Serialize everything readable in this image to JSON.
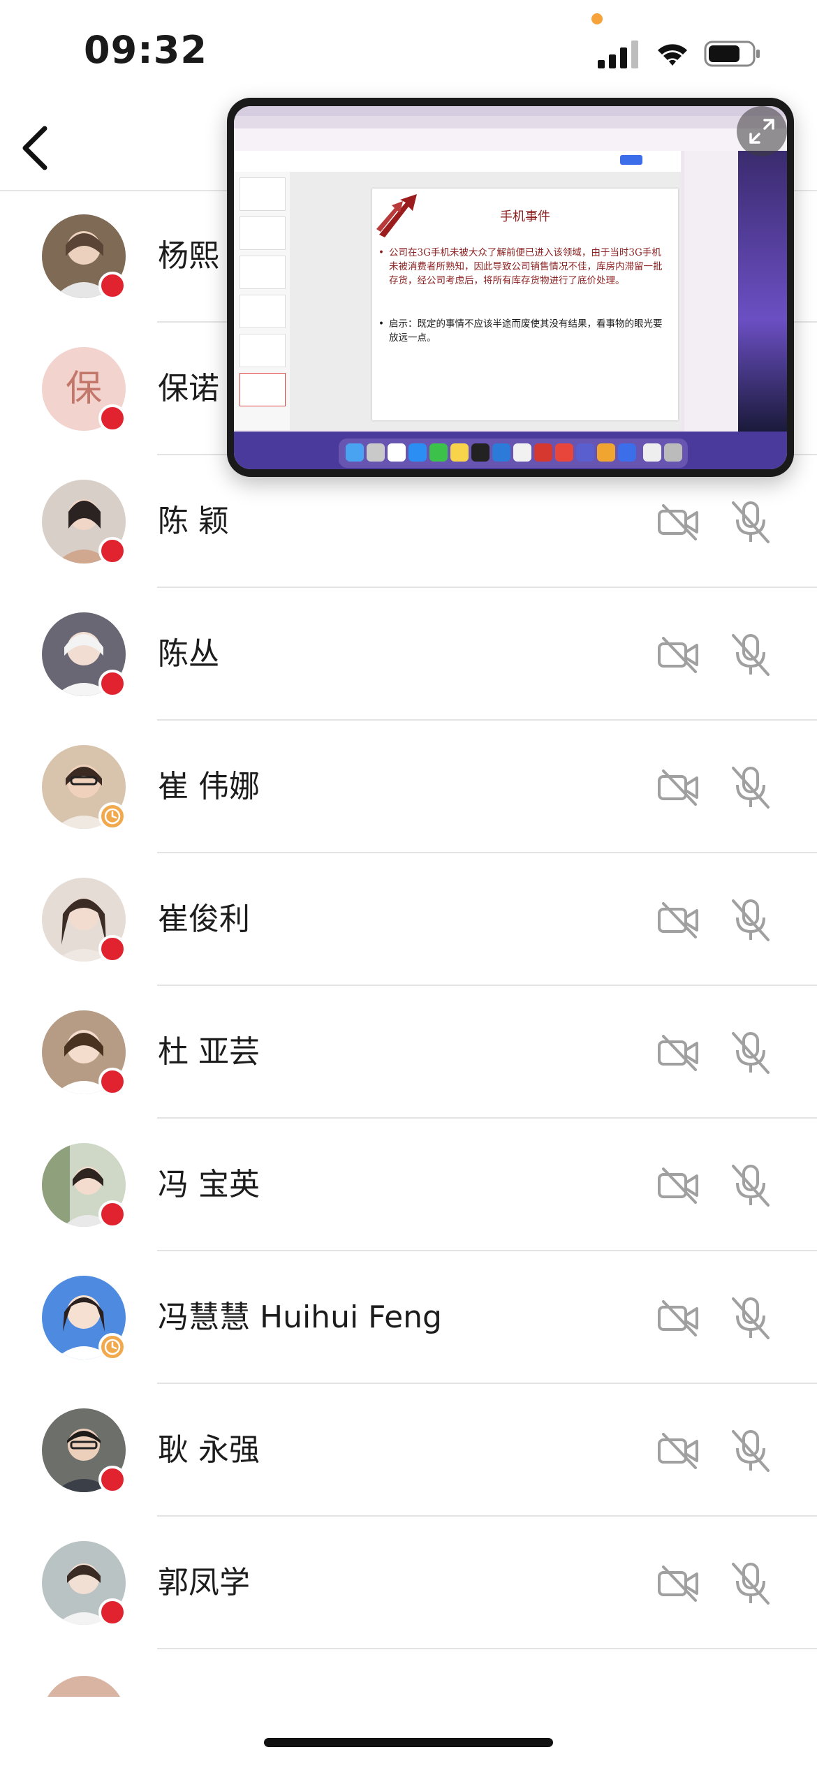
{
  "status_bar": {
    "time": "09:32"
  },
  "slide": {
    "title": "手机事件",
    "paragraph1": "公司在3G手机未被大众了解前便已进入该领域，由于当时3G手机未被消费者所熟知，因此导致公司销售情况不佳，库房内滞留一批存货，经公司考虑后，将所有库存货物进行了底价处理。",
    "paragraph2": "启示：既定的事情不应该半途而废使其没有结果，看事物的眼光要放远一点。"
  },
  "participants": [
    {
      "name": "杨熙",
      "status": "red",
      "avatar_color": "#8a6d55"
    },
    {
      "name": "保诺",
      "avatar_letter": "保",
      "status": "red"
    },
    {
      "name": "陈 颖",
      "status": "red",
      "avatar_color": "#b9a7a0"
    },
    {
      "name": "陈丛",
      "status": "red",
      "avatar_color": "#6d6a78"
    },
    {
      "name": "崔 伟娜",
      "status": "clock",
      "avatar_color": "#c7b09b"
    },
    {
      "name": "崔俊利",
      "status": "red",
      "avatar_color": "#a48b7c"
    },
    {
      "name": "杜 亚芸",
      "status": "red",
      "avatar_color": "#b59a84"
    },
    {
      "name": "冯 宝英",
      "status": "red",
      "avatar_color": "#8f9a86"
    },
    {
      "name": "冯慧慧 Huihui Feng",
      "status": "clock",
      "avatar_color": "#4f8ce0"
    },
    {
      "name": "耿 永强",
      "status": "red",
      "avatar_color": "#6b6e6a"
    },
    {
      "name": "郭凤学",
      "status": "red",
      "avatar_color": "#a7b2b3"
    }
  ]
}
